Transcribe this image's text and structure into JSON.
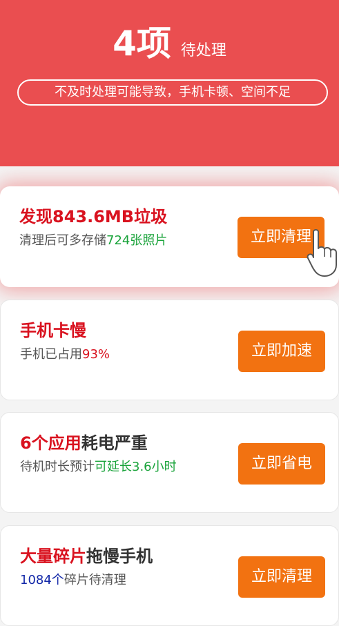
{
  "header": {
    "count": "4项",
    "count_suffix": "待处理",
    "warning": "不及时处理可能导致，手机卡顿、空间不足"
  },
  "cards": [
    {
      "title_highlight": "发现843.6MB垃圾",
      "title_rest": "",
      "sub_prefix": "清理后可多存储",
      "sub_highlight": "724张照片",
      "sub_suffix": "",
      "button": "立即清理"
    },
    {
      "title_highlight": "手机卡慢",
      "title_rest": "",
      "sub_prefix": "手机已占用",
      "sub_highlight": "93%",
      "sub_suffix": "",
      "button": "立即加速"
    },
    {
      "title_highlight": "6个应用",
      "title_rest": "耗电严重",
      "sub_prefix": "待机时长预计",
      "sub_highlight": "可延长3.6小时",
      "sub_suffix": "",
      "button": "立即省电"
    },
    {
      "title_highlight": "大量碎片",
      "title_rest": "拖慢手机",
      "sub_prefix": "",
      "sub_highlight": "1084个",
      "sub_suffix": "碎片待清理",
      "button": "立即清理"
    }
  ],
  "colors": {
    "header_bg": "#ea4e50",
    "button_bg": "#f27211",
    "highlight_red": "#d9121f",
    "highlight_green": "#19a33a",
    "highlight_blue": "#1328a8"
  },
  "icons": {
    "pointer": "pointing-hand-icon"
  }
}
